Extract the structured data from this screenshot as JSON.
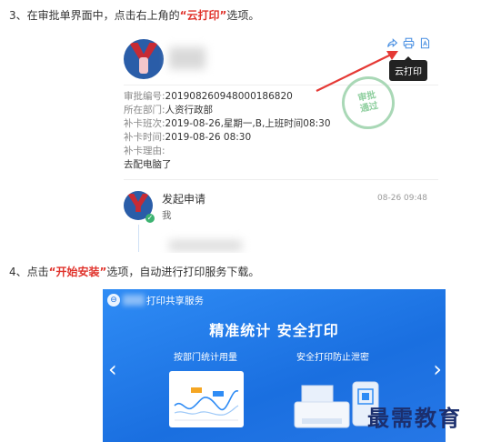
{
  "step3": {
    "prefix": "3、在审批单界面中，点击右上角的",
    "highlight": "“云打印”",
    "suffix": "选项。"
  },
  "card": {
    "tooltip": "云打印",
    "actions": [
      {
        "icon": "share-icon"
      },
      {
        "icon": "print-icon"
      },
      {
        "icon": "pdf-icon"
      }
    ],
    "fields": [
      {
        "key": "审批编号:",
        "value": "201908260948000186820"
      },
      {
        "key": "所在部门:",
        "value": "人资行政部"
      },
      {
        "key": "补卡班次:",
        "value": "2019-08-26,星期一,B,上班时间08:30"
      },
      {
        "key": "补卡时间:",
        "value": "2019-08-26 08:30"
      },
      {
        "key": "补卡理由:",
        "value": ""
      }
    ],
    "reason": "去配电脑了",
    "stamp": [
      "审批",
      "通过"
    ],
    "timeline": {
      "title": "发起申请",
      "subtitle": "我",
      "time": "08-26 09:48"
    }
  },
  "step4": {
    "prefix": "4、点击",
    "highlight": "“开始安装”",
    "suffix": "选项，自动进行打印服务下载。"
  },
  "banner": {
    "app_title": "打印共享服务",
    "headline": "精准统计  安全打印",
    "feature1": "按部门统计用量",
    "feature2": "安全打印防止泄密",
    "prev": "‹",
    "next": "›"
  },
  "watermark": "最需教育",
  "colors": {
    "highlight": "#e0322b",
    "accent": "#4a90e2",
    "banner": "#1a6fe0"
  }
}
